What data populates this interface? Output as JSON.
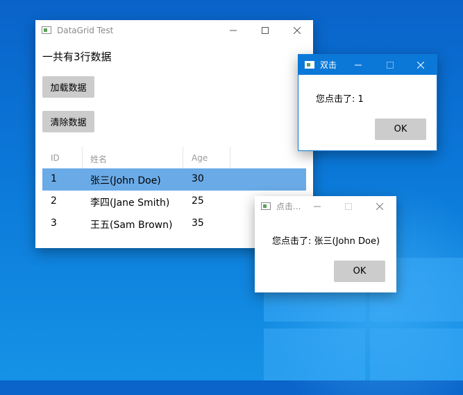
{
  "main_window": {
    "title": "DataGrid Test",
    "count_text": "一共有3行数据",
    "load_button": "加载数据",
    "clear_button": "清除数据",
    "columns": [
      "ID",
      "姓名",
      "Age"
    ],
    "rows": [
      {
        "id": "1",
        "name": "张三(John Doe)",
        "age": "30",
        "selected": true
      },
      {
        "id": "2",
        "name": "李四(Jane Smith)",
        "age": "25",
        "selected": false
      },
      {
        "id": "3",
        "name": "王五(Sam Brown)",
        "age": "35",
        "selected": false
      }
    ]
  },
  "dialog_row": {
    "title": "双击",
    "message": "您点击了: 1",
    "ok_label": "OK"
  },
  "dialog_cell": {
    "title": "点击...",
    "message": "您点击了: 张三(John Doe)",
    "ok_label": "OK"
  },
  "colors": {
    "accent": "#0b78d8",
    "selection": "#6aaae6",
    "button": "#cccccc"
  }
}
